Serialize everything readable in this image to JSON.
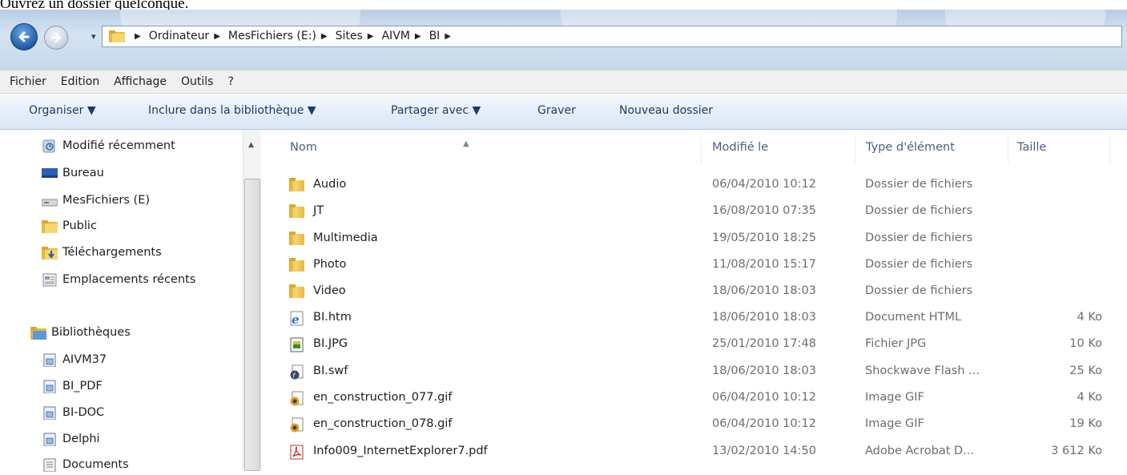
{
  "caption": "Ouvrez un dossier quelconque.",
  "address": {
    "history_arrow": "▾",
    "crumbs": [
      "Ordinateur",
      "MesFichiers (E:)",
      "Sites",
      "AIVM",
      "BI"
    ],
    "separator": "▶"
  },
  "menu": [
    "Fichier",
    "Edition",
    "Affichage",
    "Outils",
    "?"
  ],
  "commands": {
    "organize": "Organiser ▼",
    "include": "Inclure dans la bibliothèque ▼",
    "share": "Partager avec ▼",
    "burn": "Graver",
    "new_folder": "Nouveau dossier"
  },
  "nav": {
    "favorites": [
      {
        "label": "Modifié récemment",
        "icon": "recent-places-icon"
      },
      {
        "label": "Bureau",
        "icon": "desktop-icon"
      },
      {
        "label": "MesFichiers (E)",
        "icon": "drive-icon"
      },
      {
        "label": "Public",
        "icon": "folder-icon"
      },
      {
        "label": "Téléchargements",
        "icon": "downloads-folder-icon"
      },
      {
        "label": "Emplacements récents",
        "icon": "recent-locations-icon"
      }
    ],
    "libraries_label": "Bibliothèques",
    "libraries": [
      {
        "label": "AIVM37",
        "icon": "library-icon"
      },
      {
        "label": "BI_PDF",
        "icon": "library-icon"
      },
      {
        "label": "BI-DOC",
        "icon": "library-icon"
      },
      {
        "label": "Delphi",
        "icon": "library-icon"
      },
      {
        "label": "Documents",
        "icon": "documents-library-icon"
      }
    ]
  },
  "columns": {
    "name": "Nom",
    "modified": "Modifié le",
    "type": "Type d'élément",
    "size": "Taille"
  },
  "files": [
    {
      "name": "Audio",
      "modified": "06/04/2010 10:12",
      "type": "Dossier de fichiers",
      "size": "",
      "icon": "folder-icon"
    },
    {
      "name": "JT",
      "modified": "16/08/2010 07:35",
      "type": "Dossier de fichiers",
      "size": "",
      "icon": "folder-icon"
    },
    {
      "name": "Multimedia",
      "modified": "19/05/2010 18:25",
      "type": "Dossier de fichiers",
      "size": "",
      "icon": "folder-icon"
    },
    {
      "name": "Photo",
      "modified": "11/08/2010 15:17",
      "type": "Dossier de fichiers",
      "size": "",
      "icon": "folder-icon"
    },
    {
      "name": "Video",
      "modified": "18/06/2010 18:03",
      "type": "Dossier de fichiers",
      "size": "",
      "icon": "folder-icon"
    },
    {
      "name": "BI.htm",
      "modified": "18/06/2010 18:03",
      "type": "Document HTML",
      "size": "4 Ko",
      "icon": "html-file-icon"
    },
    {
      "name": "BI.JPG",
      "modified": "25/01/2010 17:48",
      "type": "Fichier JPG",
      "size": "10 Ko",
      "icon": "jpg-file-icon"
    },
    {
      "name": "BI.swf",
      "modified": "18/06/2010 18:03",
      "type": "Shockwave Flash ...",
      "size": "25 Ko",
      "icon": "swf-file-icon"
    },
    {
      "name": "en_construction_077.gif",
      "modified": "06/04/2010 10:12",
      "type": "Image GIF",
      "size": "4 Ko",
      "icon": "gif-file-icon"
    },
    {
      "name": "en_construction_078.gif",
      "modified": "06/04/2010 10:12",
      "type": "Image GIF",
      "size": "19 Ko",
      "icon": "gif-file-icon"
    },
    {
      "name": "Info009_InternetExplorer7.pdf",
      "modified": "13/02/2010 14:50",
      "type": "Adobe Acrobat D...",
      "size": "3 612 Ko",
      "icon": "pdf-file-icon"
    }
  ]
}
